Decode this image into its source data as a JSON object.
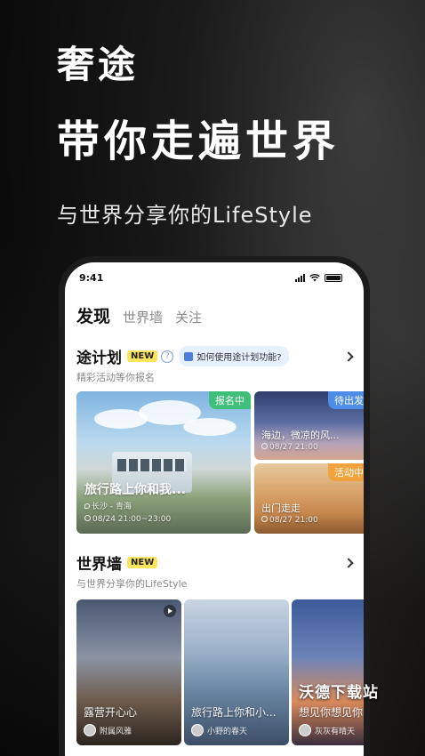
{
  "hero": {
    "title": "奢途",
    "slogan": "带你走遍世界",
    "subtitle": "与世界分享你的LifeStyle"
  },
  "status_bar": {
    "time": "9:41"
  },
  "tabs": [
    "发现",
    "世界墙",
    "关注"
  ],
  "plan": {
    "title": "途计划",
    "badge": "NEW",
    "tip": "如何使用途计划功能?",
    "subtitle": "精彩活动等你报名",
    "cards": [
      {
        "tag": "报名中",
        "title": "旅行路上你和我...",
        "location": "长沙 - 青海",
        "time": "08/24 21:00~23:00"
      },
      {
        "tag": "待出发",
        "title": "海边，微凉的风...",
        "time": "08/27 21:00"
      },
      {
        "tag": "活动中",
        "title": "出门走走",
        "time": "08/27 21:00"
      }
    ]
  },
  "wall": {
    "title": "世界墙",
    "badge": "NEW",
    "subtitle": "与世界分享你的LifeStyle",
    "cards": [
      {
        "title": "露营开心心",
        "author": "附属风雅",
        "video": true
      },
      {
        "title": "旅行路上你和小...",
        "author": "小野的春天",
        "video": false
      },
      {
        "title": "想见你想见你",
        "author": "灰灰有晴天",
        "video": false
      }
    ]
  },
  "watermark": "沃德下载站",
  "icons": [
    "signal-icon",
    "wifi-icon",
    "battery-icon",
    "help-icon",
    "chevron-right-icon",
    "video-icon",
    "location-icon",
    "clock-icon"
  ]
}
